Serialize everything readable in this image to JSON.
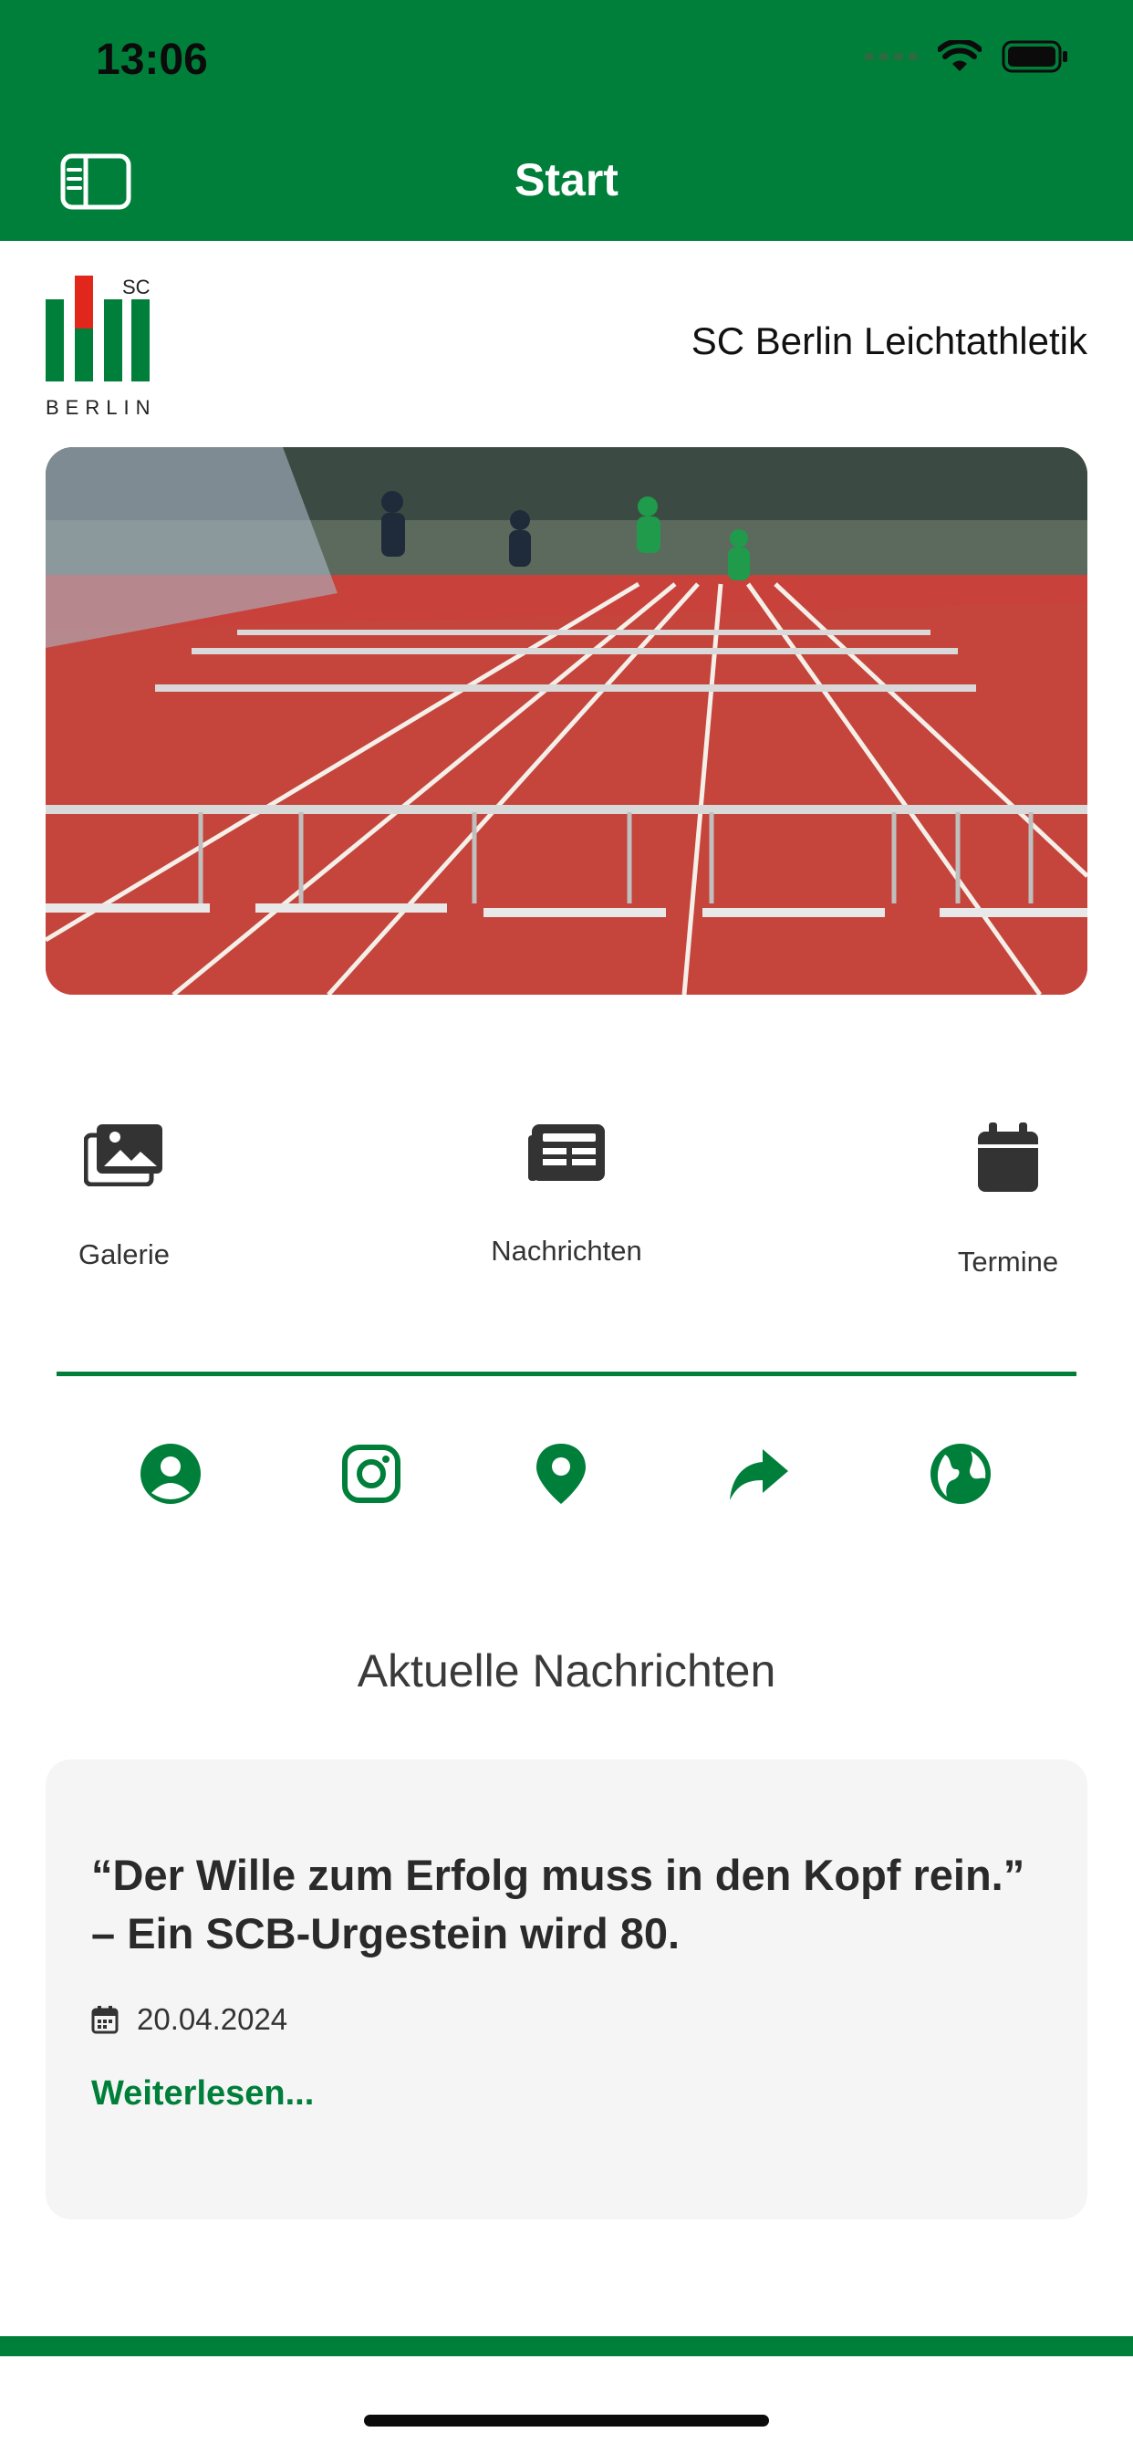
{
  "status_bar": {
    "time": "13:06"
  },
  "header": {
    "title": "Start"
  },
  "brand": {
    "logo_text_top": "SC",
    "logo_text_bottom": "BERLIN",
    "club_name": "SC Berlin Leichtathletik"
  },
  "quick_actions": [
    {
      "label": "Galerie",
      "icon": "gallery-icon"
    },
    {
      "label": "Nachrichten",
      "icon": "news-icon"
    },
    {
      "label": "Termine",
      "icon": "calendar-icon"
    }
  ],
  "social_icons": [
    "profile-icon",
    "instagram-icon",
    "location-icon",
    "share-icon",
    "globe-icon"
  ],
  "news": {
    "section_title": "Aktuelle Nachrichten",
    "item": {
      "title": "“Der Wille zum Erfolg muss in den Kopf rein.” – Ein SCB-Urgestein wird 80.",
      "date": "20.04.2024",
      "read_more": "Weiterlesen..."
    }
  },
  "colors": {
    "brand_green": "#007f3a",
    "logo_red": "#e1261c",
    "icon_dark": "#333333"
  }
}
